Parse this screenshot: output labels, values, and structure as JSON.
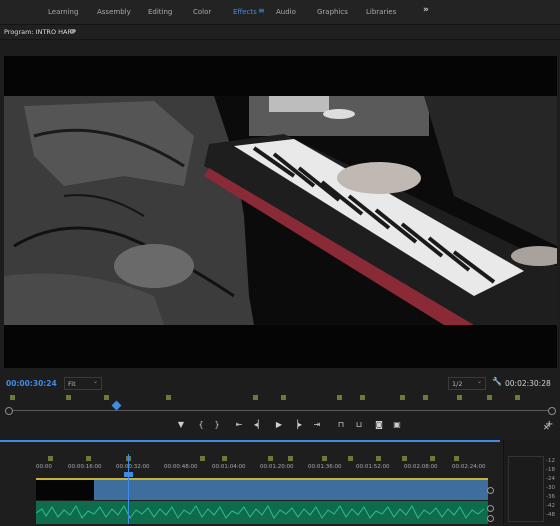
{
  "workspace_tabs": [
    "Learning",
    "Assembly",
    "Editing",
    "Color",
    "Effects",
    "Audio",
    "Graphics",
    "Libraries"
  ],
  "active_tab": "Effects",
  "workspace_more": "»",
  "program_title": "Program: INTRO HARP",
  "menu_glyph": "≡",
  "timecode_current": "00:00:30:24",
  "fit_label": "Fit",
  "resolution_label": "1/2",
  "timecode_duration": "00:02:30:28",
  "timeline_ruler": [
    "00:00",
    "00:00:16:00",
    "00:00:32:00",
    "00:00:48:00",
    "00:01:04:00",
    "00:01:20:00",
    "00:01:36:00",
    "00:01:52:00",
    "00:02:08:00",
    "00:02:24:00"
  ],
  "meter_scale": [
    "-12",
    "-18",
    "-24",
    "-30",
    "-36",
    "-42",
    "-48"
  ],
  "colors": {
    "accent": "#3e8ce8",
    "video_clip": "#3d6e9e",
    "audio_clip": "#0e6b4c",
    "marker": "#6b7a34"
  }
}
